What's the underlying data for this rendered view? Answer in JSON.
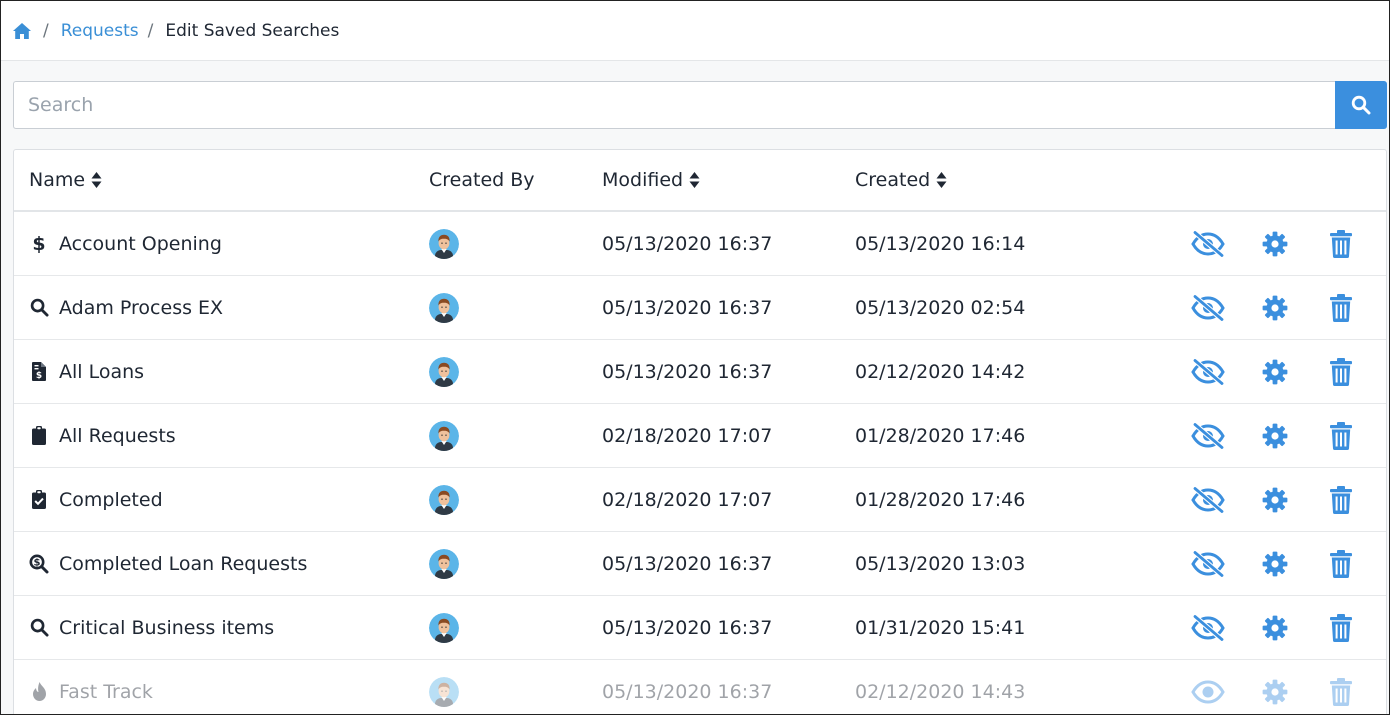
{
  "breadcrumb": {
    "home_icon": "home-icon",
    "items": [
      "Requests",
      "Edit Saved Searches"
    ],
    "separator": "/"
  },
  "search": {
    "placeholder": "Search",
    "value": "",
    "button_icon": "search-icon"
  },
  "table": {
    "columns": {
      "name": "Name",
      "created_by": "Created By",
      "modified": "Modified",
      "created": "Created"
    },
    "rows": [
      {
        "name": "Account Opening",
        "icon": "dollar-icon",
        "modified": "05/13/2020 16:37",
        "created": "05/13/2020 16:14",
        "disabled": false
      },
      {
        "name": "Adam Process EX",
        "icon": "search-icon",
        "modified": "05/13/2020 16:37",
        "created": "05/13/2020 02:54",
        "disabled": false
      },
      {
        "name": "All Loans",
        "icon": "file-invoice-dollar-icon",
        "modified": "05/13/2020 16:37",
        "created": "02/12/2020 14:42",
        "disabled": false
      },
      {
        "name": "All Requests",
        "icon": "clipboard-icon",
        "modified": "02/18/2020 17:07",
        "created": "01/28/2020 17:46",
        "disabled": false
      },
      {
        "name": "Completed",
        "icon": "clipboard-check-icon",
        "modified": "02/18/2020 17:07",
        "created": "01/28/2020 17:46",
        "disabled": false
      },
      {
        "name": "Completed Loan Requests",
        "icon": "search-dollar-icon",
        "modified": "05/13/2020 16:37",
        "created": "05/13/2020 13:03",
        "disabled": false
      },
      {
        "name": "Critical Business items",
        "icon": "search-icon",
        "modified": "05/13/2020 16:37",
        "created": "01/31/2020 15:41",
        "disabled": false
      },
      {
        "name": "Fast Track",
        "icon": "fire-icon",
        "modified": "05/13/2020 16:37",
        "created": "02/12/2020 14:43",
        "disabled": true
      }
    ]
  },
  "colors": {
    "accent": "#3b8fde",
    "link": "#3a8fd6",
    "text": "#1f2733"
  }
}
